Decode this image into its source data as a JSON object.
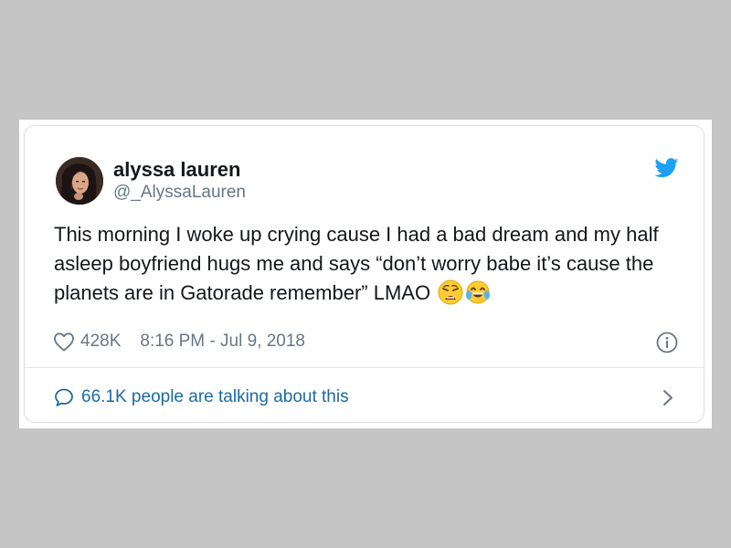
{
  "tweet": {
    "display_name": "alyssa lauren",
    "handle": "@_AlyssaLauren",
    "text": "This morning I woke up crying cause I had a bad dream and my half asleep boyfriend hugs me and says “don’t worry babe it’s cause the planets are in Gatorade remember” LMAO",
    "emojis": [
      "weary-face-emoji",
      "tears-of-joy-emoji"
    ],
    "likes": "428K",
    "timestamp": "8:16 PM - Jul 9, 2018",
    "conversation": "66.1K people are talking about this"
  },
  "icons": {
    "brand": "twitter-bird-icon",
    "like": "heart-icon",
    "info": "info-icon",
    "reply": "speech-bubble-icon",
    "more": "chevron-right-icon"
  },
  "colors": {
    "background": "#c6c5c6",
    "twitter_blue": "#1da1f2",
    "link_blue": "#1b6aa3",
    "secondary_text": "#657786",
    "primary_text": "#14171a",
    "border": "#d9dde1"
  }
}
